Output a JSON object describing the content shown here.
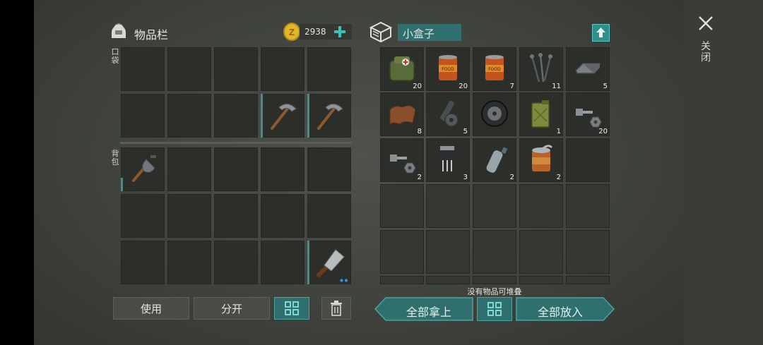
{
  "inventory": {
    "title": "物品栏",
    "coins": "2938",
    "icon": "backpack-icon",
    "pocket_label": "口袋",
    "bag_label": "背包",
    "pocket_slots": [
      {
        "item": null
      },
      {
        "item": null
      },
      {
        "item": null
      },
      {
        "item": null
      },
      {
        "item": null
      },
      {
        "item": null
      },
      {
        "item": null
      },
      {
        "item": null
      },
      {
        "item": "pickaxe",
        "durability": 1.0
      },
      {
        "item": "pickaxe",
        "durability": 1.0
      }
    ],
    "bag_slots": [
      {
        "item": "shovel",
        "durability": 0.3
      },
      {
        "item": null
      },
      {
        "item": null
      },
      {
        "item": null
      },
      {
        "item": null
      },
      {
        "item": null
      },
      {
        "item": null
      },
      {
        "item": null
      },
      {
        "item": null
      },
      {
        "item": null
      },
      {
        "item": null
      },
      {
        "item": null
      },
      {
        "item": null
      },
      {
        "item": null
      },
      {
        "item": "cleaver",
        "durability": 1.0
      }
    ]
  },
  "container": {
    "title": "小盒子",
    "icon": "box-icon",
    "no_stack_text": "没有物品可堆叠",
    "items": [
      {
        "item": "first-aid-bag",
        "count": "20"
      },
      {
        "item": "food-can",
        "count": "20"
      },
      {
        "item": "food-can",
        "count": "7"
      },
      {
        "item": "nails",
        "count": "11"
      },
      {
        "item": "metal-ingot",
        "count": "5"
      },
      {
        "item": "leather",
        "count": "8"
      },
      {
        "item": "pipe-parts",
        "count": "5"
      },
      {
        "item": "tire",
        "count": ""
      },
      {
        "item": "jerrycan",
        "count": "1"
      },
      {
        "item": "bolt-nut",
        "count": "20"
      },
      {
        "item": "bolt-nut",
        "count": "2"
      },
      {
        "item": "transistor",
        "count": "3"
      },
      {
        "item": "plastic-bottle",
        "count": "2"
      },
      {
        "item": "open-can",
        "count": "2"
      }
    ],
    "total_slots": 30
  },
  "buttons": {
    "use": "使用",
    "split": "分开",
    "take_all": "全部拿上",
    "put_all": "全部放入"
  },
  "close": {
    "label": "关闭",
    "icon": "close-icon"
  },
  "colors": {
    "teal": "#2f6f6e",
    "slot": "#2c2e2a",
    "coin": "#e2b52a"
  }
}
